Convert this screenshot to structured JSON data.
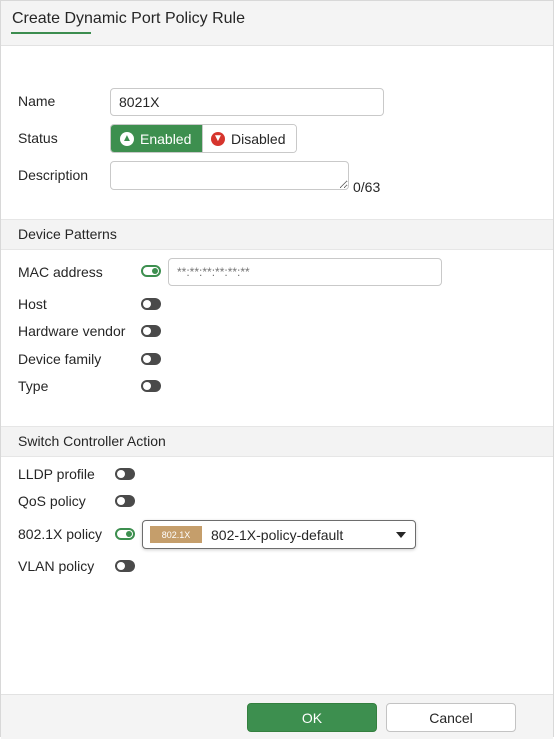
{
  "dialog": {
    "title": "Create Dynamic Port Policy Rule"
  },
  "form": {
    "name": {
      "label": "Name",
      "value": "8021X"
    },
    "status": {
      "label": "Status",
      "enabled_label": "Enabled",
      "disabled_label": "Disabled",
      "selected": "Enabled"
    },
    "description": {
      "label": "Description",
      "value": "",
      "counter": "0/63"
    }
  },
  "device_patterns": {
    "title": "Device Patterns",
    "mac_address": {
      "label": "MAC address",
      "enabled": true,
      "placeholder": "**:**:**:**:**:**"
    },
    "host": {
      "label": "Host",
      "enabled": false
    },
    "hardware_vendor": {
      "label": "Hardware vendor",
      "enabled": false
    },
    "device_family": {
      "label": "Device family",
      "enabled": false
    },
    "type": {
      "label": "Type",
      "enabled": false
    }
  },
  "switch_controller_action": {
    "title": "Switch Controller Action",
    "lldp_profile": {
      "label": "LLDP profile",
      "enabled": false
    },
    "qos_policy": {
      "label": "QoS policy",
      "enabled": false
    },
    "dot1x_policy": {
      "label": "802.1X policy",
      "enabled": true,
      "badge": "802.1X",
      "value": "802-1X-policy-default"
    },
    "vlan_policy": {
      "label": "VLAN policy",
      "enabled": false
    }
  },
  "footer": {
    "ok_label": "OK",
    "cancel_label": "Cancel"
  },
  "colors": {
    "accent": "#3d8f4f",
    "disabled_icon": "#d6352d",
    "badge": "#c59e6b"
  },
  "icons": {
    "enabled": "arrow-up-circle-icon",
    "disabled": "arrow-down-circle-icon",
    "dropdown": "caret-down-icon"
  }
}
